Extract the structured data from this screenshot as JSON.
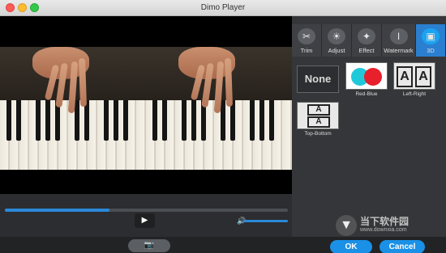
{
  "window": {
    "title": "Dimo Player"
  },
  "tabs": [
    {
      "label": "Trim",
      "icon": "scissors-icon"
    },
    {
      "label": "Adjust",
      "icon": "brightness-icon"
    },
    {
      "label": "Effect",
      "icon": "magic-wand-icon"
    },
    {
      "label": "Watermark",
      "icon": "text-cursor-icon"
    },
    {
      "label": "3D",
      "icon": "3d-camera-icon",
      "active": true
    }
  ],
  "modes": [
    {
      "label": "None",
      "thumb": "None"
    },
    {
      "label": "Red-Blue"
    },
    {
      "label": "Left-Right",
      "thumb": "A"
    },
    {
      "label": "Top-Bottom",
      "thumb": "A"
    }
  ],
  "playback": {
    "progress": 0.37,
    "volume": 1.0
  },
  "footer": {
    "ok": "OK",
    "cancel": "Cancel"
  },
  "watermark": {
    "brand": "当下软件园",
    "url": "www.downxia.com"
  },
  "colors": {
    "accent": "#1a90e6",
    "active_tab": "#2b7fd0"
  }
}
